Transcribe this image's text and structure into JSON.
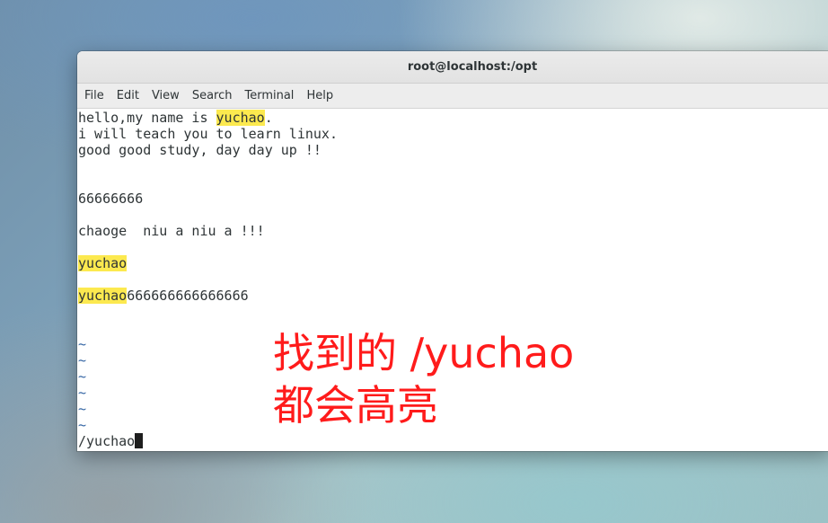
{
  "window": {
    "title": "root@localhost:/opt"
  },
  "menu": [
    {
      "label": "File"
    },
    {
      "label": "Edit"
    },
    {
      "label": "View"
    },
    {
      "label": "Search"
    },
    {
      "label": "Terminal"
    },
    {
      "label": "Help"
    }
  ],
  "terminal": {
    "lines": [
      {
        "pre": "hello,my name is ",
        "match": "yuchao",
        "post": "."
      },
      {
        "text": "i will teach you to learn linux."
      },
      {
        "text": "good good study, day day up !!"
      },
      {
        "text": ""
      },
      {
        "text": ""
      },
      {
        "text": "66666666"
      },
      {
        "text": ""
      },
      {
        "text": "chaoge  niu a niu a !!!"
      },
      {
        "text": ""
      },
      {
        "pre": "",
        "match": "yuchao",
        "post": ""
      },
      {
        "text": ""
      },
      {
        "pre": "",
        "match": "yuchao",
        "post": "666666666666666"
      },
      {
        "text": ""
      },
      {
        "text": ""
      }
    ],
    "tilde": "~",
    "command": "/yuchao"
  },
  "annotation": {
    "line1": "找到的 /yuchao",
    "line2": "都会高亮",
    "color": "#ff1b1b"
  },
  "colors": {
    "highlight": "#fce94f",
    "tilde": "#3465a4"
  }
}
